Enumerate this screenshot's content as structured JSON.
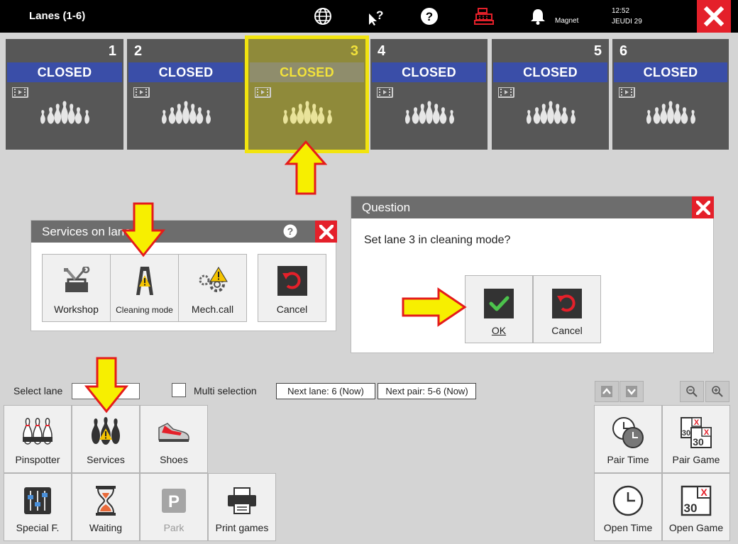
{
  "topbar": {
    "title": "Lanes (1-6)",
    "user": "Magnet",
    "time": "12:52",
    "day": "JEUDI 29",
    "icons": [
      "globe-icon",
      "cursor-help-icon",
      "help-icon",
      "cash-register-icon",
      "bell-icon",
      "close-icon"
    ]
  },
  "lanes": [
    {
      "number": "1",
      "status": "CLOSED"
    },
    {
      "number": "2",
      "status": "CLOSED"
    },
    {
      "number": "3",
      "status": "CLOSED"
    },
    {
      "number": "4",
      "status": "CLOSED"
    },
    {
      "number": "5",
      "status": "CLOSED"
    },
    {
      "number": "6",
      "status": "CLOSED"
    }
  ],
  "services_dialog": {
    "title": "Services on lane",
    "buttons": {
      "workshop": "Workshop",
      "cleaning": "Cleaning mode",
      "mech_call": "Mech.call",
      "cancel": "Cancel"
    }
  },
  "question_dialog": {
    "title": "Question",
    "message": "Set lane 3 in cleaning mode?",
    "ok": "OK",
    "cancel": "Cancel"
  },
  "toolbar": {
    "select_lane_label": "Select lane",
    "select_lane_value": "",
    "multi_selection_label": "Multi selection",
    "next_lane": "Next lane: 6 (Now)",
    "next_pair": "Next pair: 5-6 (Now)"
  },
  "bottom": {
    "pinspotter": "Pinspotter",
    "services": "Services",
    "shoes": "Shoes",
    "special": "Special F.",
    "waiting": "Waiting",
    "park": "Park",
    "print_games": "Print games",
    "pair_time": "Pair Time",
    "pair_game": "Pair Game",
    "open_time": "Open Time",
    "open_game": "Open Game"
  },
  "colors": {
    "closed_bar": "#3a4ea8",
    "selected_outline": "#f2e40e",
    "close_red": "#e4202a",
    "arrow_yellow": "#f7ef00",
    "arrow_red": "#e41b1b"
  }
}
